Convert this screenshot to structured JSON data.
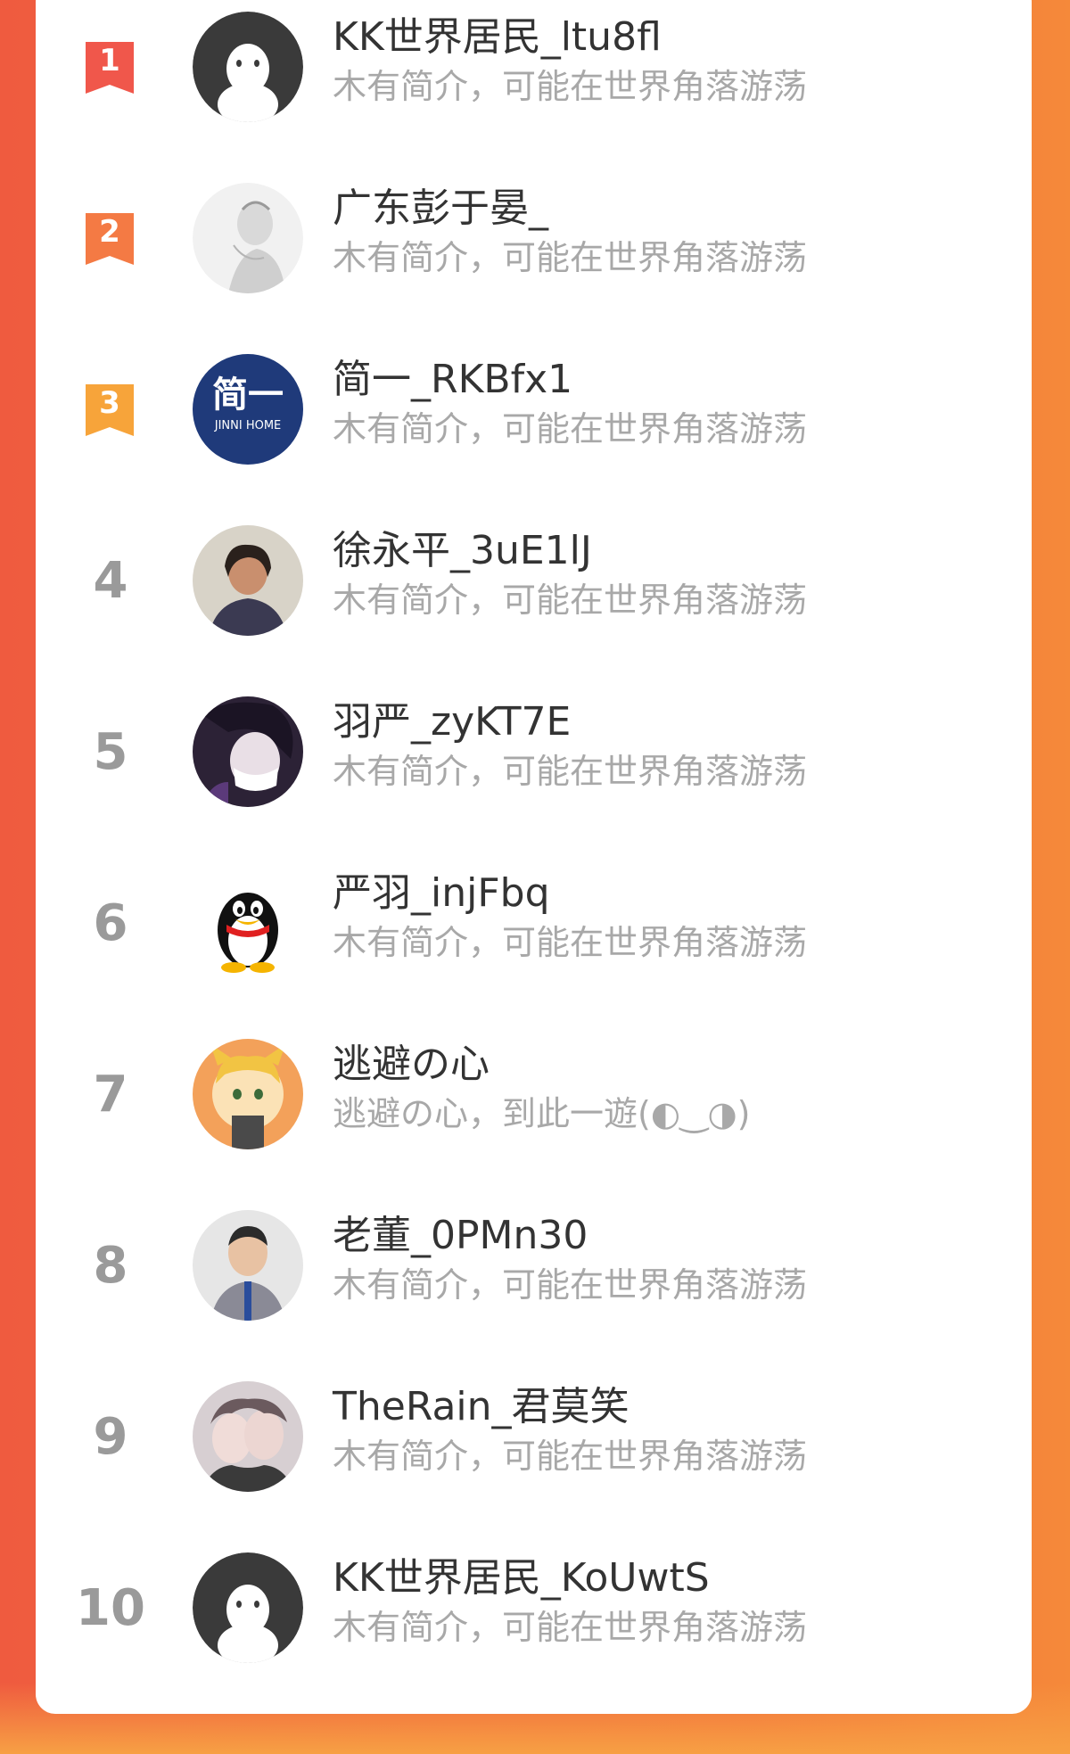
{
  "ranking": {
    "items": [
      {
        "rank": "1",
        "name": "KK世界居民_ltu8fl",
        "desc": "木有简介，可能在世界角落游荡",
        "badge_color": "#f0574b",
        "avatar": "default-ghost"
      },
      {
        "rank": "2",
        "name": "广东彭于晏_",
        "desc": "木有简介，可能在世界角落游荡",
        "badge_color": "#f47a44",
        "avatar": "sketch-portrait"
      },
      {
        "rank": "3",
        "name": "简一_RKBfx1",
        "desc": "木有简介，可能在世界角落游荡",
        "badge_color": "#f7a43a",
        "avatar": "jinni-home-logo"
      },
      {
        "rank": "4",
        "name": "徐永平_3uE1lJ",
        "desc": "木有简介，可能在世界角落游荡",
        "avatar": "person-photo"
      },
      {
        "rank": "5",
        "name": "羽严_zyKT7E",
        "desc": "木有简介，可能在世界角落游荡",
        "avatar": "anime-masked"
      },
      {
        "rank": "6",
        "name": "严羽_injFbq",
        "desc": "木有简介，可能在世界角落游荡",
        "avatar": "penguin"
      },
      {
        "rank": "7",
        "name": "逃避の心",
        "desc": "逃避の心，到此一遊(◐‿◑)",
        "avatar": "anime-fox"
      },
      {
        "rank": "8",
        "name": "老董_0PMn30",
        "desc": "木有简介，可能在世界角落游荡",
        "avatar": "child-photo"
      },
      {
        "rank": "9",
        "name": "TheRain_君莫笑",
        "desc": "木有简介，可能在世界角落游荡",
        "avatar": "couple-photo"
      },
      {
        "rank": "10",
        "name": "KK世界居民_KoUwtS",
        "desc": "木有简介，可能在世界角落游荡",
        "avatar": "default-ghost"
      }
    ]
  },
  "avatar_logo": {
    "line1": "简一",
    "line2": "JINNI HOME"
  },
  "colors": {
    "background_left": "#ef5b3f",
    "background_right": "#f5893a",
    "card": "#ffffff",
    "name_text": "#333333",
    "desc_text": "#a8a8a8",
    "rank_text": "#9a9a9a"
  }
}
